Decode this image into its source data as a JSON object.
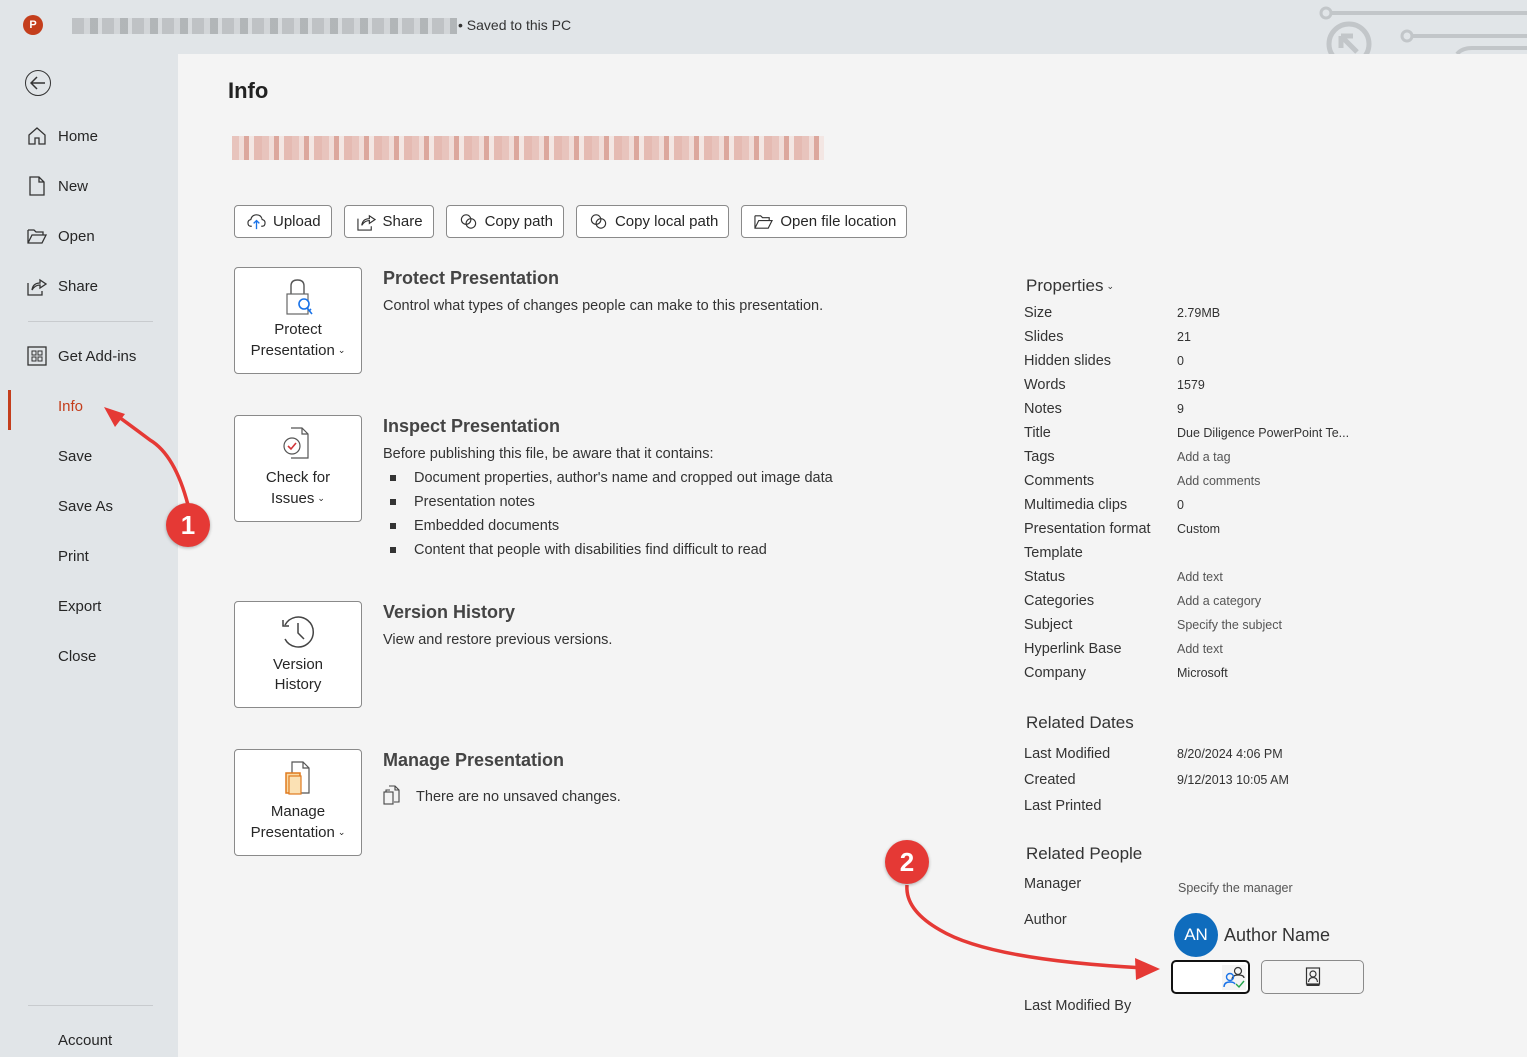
{
  "titlebar": {
    "app_icon": "P",
    "saved_status": "• Saved to this PC"
  },
  "sidebar": {
    "back_icon": "back-arrow-icon",
    "items": [
      {
        "label": "Home",
        "icon": "home-icon"
      },
      {
        "label": "New",
        "icon": "new-document-icon"
      },
      {
        "label": "Open",
        "icon": "folder-open-icon"
      },
      {
        "label": "Share",
        "icon": "share-icon"
      },
      {
        "label": "Get Add-ins",
        "icon": "add-ins-icon"
      },
      {
        "label": "Info",
        "active": true
      },
      {
        "label": "Save"
      },
      {
        "label": "Save As"
      },
      {
        "label": "Print"
      },
      {
        "label": "Export"
      },
      {
        "label": "Close"
      }
    ],
    "account_label": "Account"
  },
  "main": {
    "title": "Info",
    "actions": [
      {
        "label": "Upload",
        "icon": "cloud-upload-icon"
      },
      {
        "label": "Share",
        "icon": "share-icon"
      },
      {
        "label": "Copy path",
        "icon": "link-icon"
      },
      {
        "label": "Copy local path",
        "icon": "link-icon"
      },
      {
        "label": "Open file location",
        "icon": "folder-open-icon"
      }
    ],
    "sections": {
      "protect": {
        "tile_line1": "Protect",
        "tile_line2": "Presentation",
        "title": "Protect Presentation",
        "desc": "Control what types of changes people can make to this presentation."
      },
      "inspect": {
        "tile_line1": "Check for",
        "tile_line2": "Issues",
        "title": "Inspect Presentation",
        "desc": "Before publishing this file, be aware that it contains:",
        "bullets": [
          "Document properties, author's name and cropped out image data",
          "Presentation notes",
          "Embedded documents",
          "Content that people with disabilities find difficult to read"
        ]
      },
      "version": {
        "tile_line1": "Version",
        "tile_line2": "History",
        "title": "Version History",
        "desc": "View and restore previous versions."
      },
      "manage": {
        "tile_line1": "Manage",
        "tile_line2": "Presentation",
        "title": "Manage Presentation",
        "desc": "There are no unsaved changes."
      }
    }
  },
  "properties": {
    "heading": "Properties",
    "rows": [
      {
        "key": "Size",
        "value": "2.79MB"
      },
      {
        "key": "Slides",
        "value": "21"
      },
      {
        "key": "Hidden slides",
        "value": "0"
      },
      {
        "key": "Words",
        "value": "1579"
      },
      {
        "key": "Notes",
        "value": "9"
      },
      {
        "key": "Title",
        "value": "Due Diligence PowerPoint Te..."
      },
      {
        "key": "Tags",
        "value": "Add a tag"
      },
      {
        "key": "Comments",
        "value": "Add comments"
      },
      {
        "key": "Multimedia clips",
        "value": "0"
      },
      {
        "key": "Presentation format",
        "value": "Custom"
      },
      {
        "key": "Template",
        "value": ""
      },
      {
        "key": "Status",
        "value": "Add text"
      },
      {
        "key": "Categories",
        "value": "Add a category"
      },
      {
        "key": "Subject",
        "value": "Specify the subject"
      },
      {
        "key": "Hyperlink Base",
        "value": "Add text"
      },
      {
        "key": "Company",
        "value": "Microsoft"
      }
    ]
  },
  "related_dates": {
    "heading": "Related Dates",
    "rows": [
      {
        "key": "Last Modified",
        "value": "8/20/2024 4:06 PM"
      },
      {
        "key": "Created",
        "value": "9/12/2013 10:05 AM"
      },
      {
        "key": "Last Printed",
        "value": ""
      }
    ]
  },
  "related_people": {
    "heading": "Related People",
    "manager_label": "Manager",
    "manager_value": "Specify the manager",
    "author_label": "Author",
    "author_initials": "AN",
    "author_name": "Author Name",
    "author_input_value": "",
    "last_modified_by_label": "Last Modified By"
  },
  "annotations": {
    "badge1": "1",
    "badge2": "2"
  },
  "colors": {
    "accent": "#c43e1c",
    "avatar": "#0f6cbd",
    "annotation": "#e53935"
  }
}
